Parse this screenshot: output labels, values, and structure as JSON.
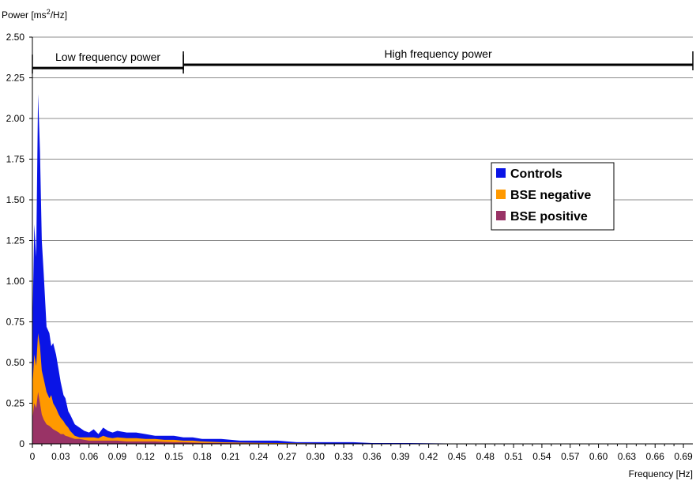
{
  "chart_data": {
    "type": "area",
    "stacked": false,
    "ylabel_prefix": "Power [ms",
    "ylabel_sup": "2",
    "ylabel_suffix": "/Hz]",
    "xlabel": "Frequency [Hz]",
    "xlim": [
      0,
      0.7
    ],
    "ylim": [
      0,
      2.5
    ],
    "grid": true,
    "legend_position": "right",
    "yticks": [
      "0",
      "0.25",
      "0.50",
      "0.75",
      "1.00",
      "1.25",
      "1.50",
      "1.75",
      "2.00",
      "2.25",
      "2.50"
    ],
    "xticks": [
      "0",
      "0.03",
      "0.06",
      "0.09",
      "0.12",
      "0.15",
      "0.18",
      "0.21",
      "0.24",
      "0.27",
      "0.30",
      "0.33",
      "0.36",
      "0.39",
      "0.42",
      "0.45",
      "0.48",
      "0.51",
      "0.54",
      "0.57",
      "0.60",
      "0.63",
      "0.66",
      "0.69"
    ],
    "x": [
      0,
      0.002,
      0.004,
      0.006,
      0.008,
      0.01,
      0.012,
      0.015,
      0.018,
      0.02,
      0.022,
      0.025,
      0.028,
      0.03,
      0.033,
      0.035,
      0.038,
      0.04,
      0.045,
      0.05,
      0.055,
      0.06,
      0.065,
      0.07,
      0.075,
      0.08,
      0.085,
      0.09,
      0.1,
      0.11,
      0.12,
      0.13,
      0.14,
      0.15,
      0.16,
      0.17,
      0.18,
      0.2,
      0.22,
      0.24,
      0.26,
      0.28,
      0.3,
      0.32,
      0.34,
      0.36,
      0.4,
      0.45,
      0.5,
      0.7
    ],
    "series": [
      {
        "name": "Controls",
        "color": "#0a14e6",
        "values": [
          0.7,
          1.35,
          1.15,
          2.15,
          1.8,
          1.25,
          1.05,
          0.72,
          0.68,
          0.6,
          0.62,
          0.55,
          0.45,
          0.38,
          0.3,
          0.28,
          0.2,
          0.18,
          0.12,
          0.1,
          0.08,
          0.07,
          0.09,
          0.06,
          0.1,
          0.08,
          0.07,
          0.08,
          0.07,
          0.07,
          0.06,
          0.05,
          0.05,
          0.05,
          0.04,
          0.04,
          0.03,
          0.03,
          0.02,
          0.02,
          0.02,
          0.01,
          0.01,
          0.01,
          0.01,
          0.005,
          0.005,
          0.002,
          0.002,
          0.001
        ]
      },
      {
        "name": "BSE negative",
        "color": "#ff9900",
        "values": [
          0.35,
          0.55,
          0.48,
          0.68,
          0.6,
          0.45,
          0.4,
          0.32,
          0.28,
          0.3,
          0.25,
          0.22,
          0.18,
          0.16,
          0.14,
          0.12,
          0.1,
          0.08,
          0.05,
          0.04,
          0.04,
          0.04,
          0.04,
          0.035,
          0.05,
          0.04,
          0.035,
          0.04,
          0.035,
          0.035,
          0.03,
          0.03,
          0.025,
          0.025,
          0.02,
          0.02,
          0.015,
          0.01,
          0.008,
          0.006,
          0.005,
          0.004,
          0.003,
          0.002,
          0.002,
          0.001,
          0.001,
          0.001,
          0,
          0
        ]
      },
      {
        "name": "BSE positive",
        "color": "#993366",
        "values": [
          0.15,
          0.25,
          0.22,
          0.32,
          0.25,
          0.18,
          0.15,
          0.12,
          0.11,
          0.1,
          0.09,
          0.08,
          0.07,
          0.06,
          0.06,
          0.05,
          0.045,
          0.04,
          0.03,
          0.03,
          0.025,
          0.02,
          0.02,
          0.02,
          0.02,
          0.02,
          0.02,
          0.02,
          0.015,
          0.015,
          0.015,
          0.015,
          0.012,
          0.01,
          0.01,
          0.008,
          0.006,
          0.005,
          0.004,
          0.003,
          0.002,
          0.002,
          0.001,
          0.001,
          0.001,
          0,
          0,
          0,
          0,
          0
        ]
      }
    ],
    "annotations": [
      {
        "text": "Low frequency power",
        "x_start": 0,
        "x_end": 0.16,
        "y": 2.31
      },
      {
        "text": "High frequency power",
        "x_start": 0.16,
        "x_end": 0.7,
        "y": 2.33
      }
    ]
  }
}
